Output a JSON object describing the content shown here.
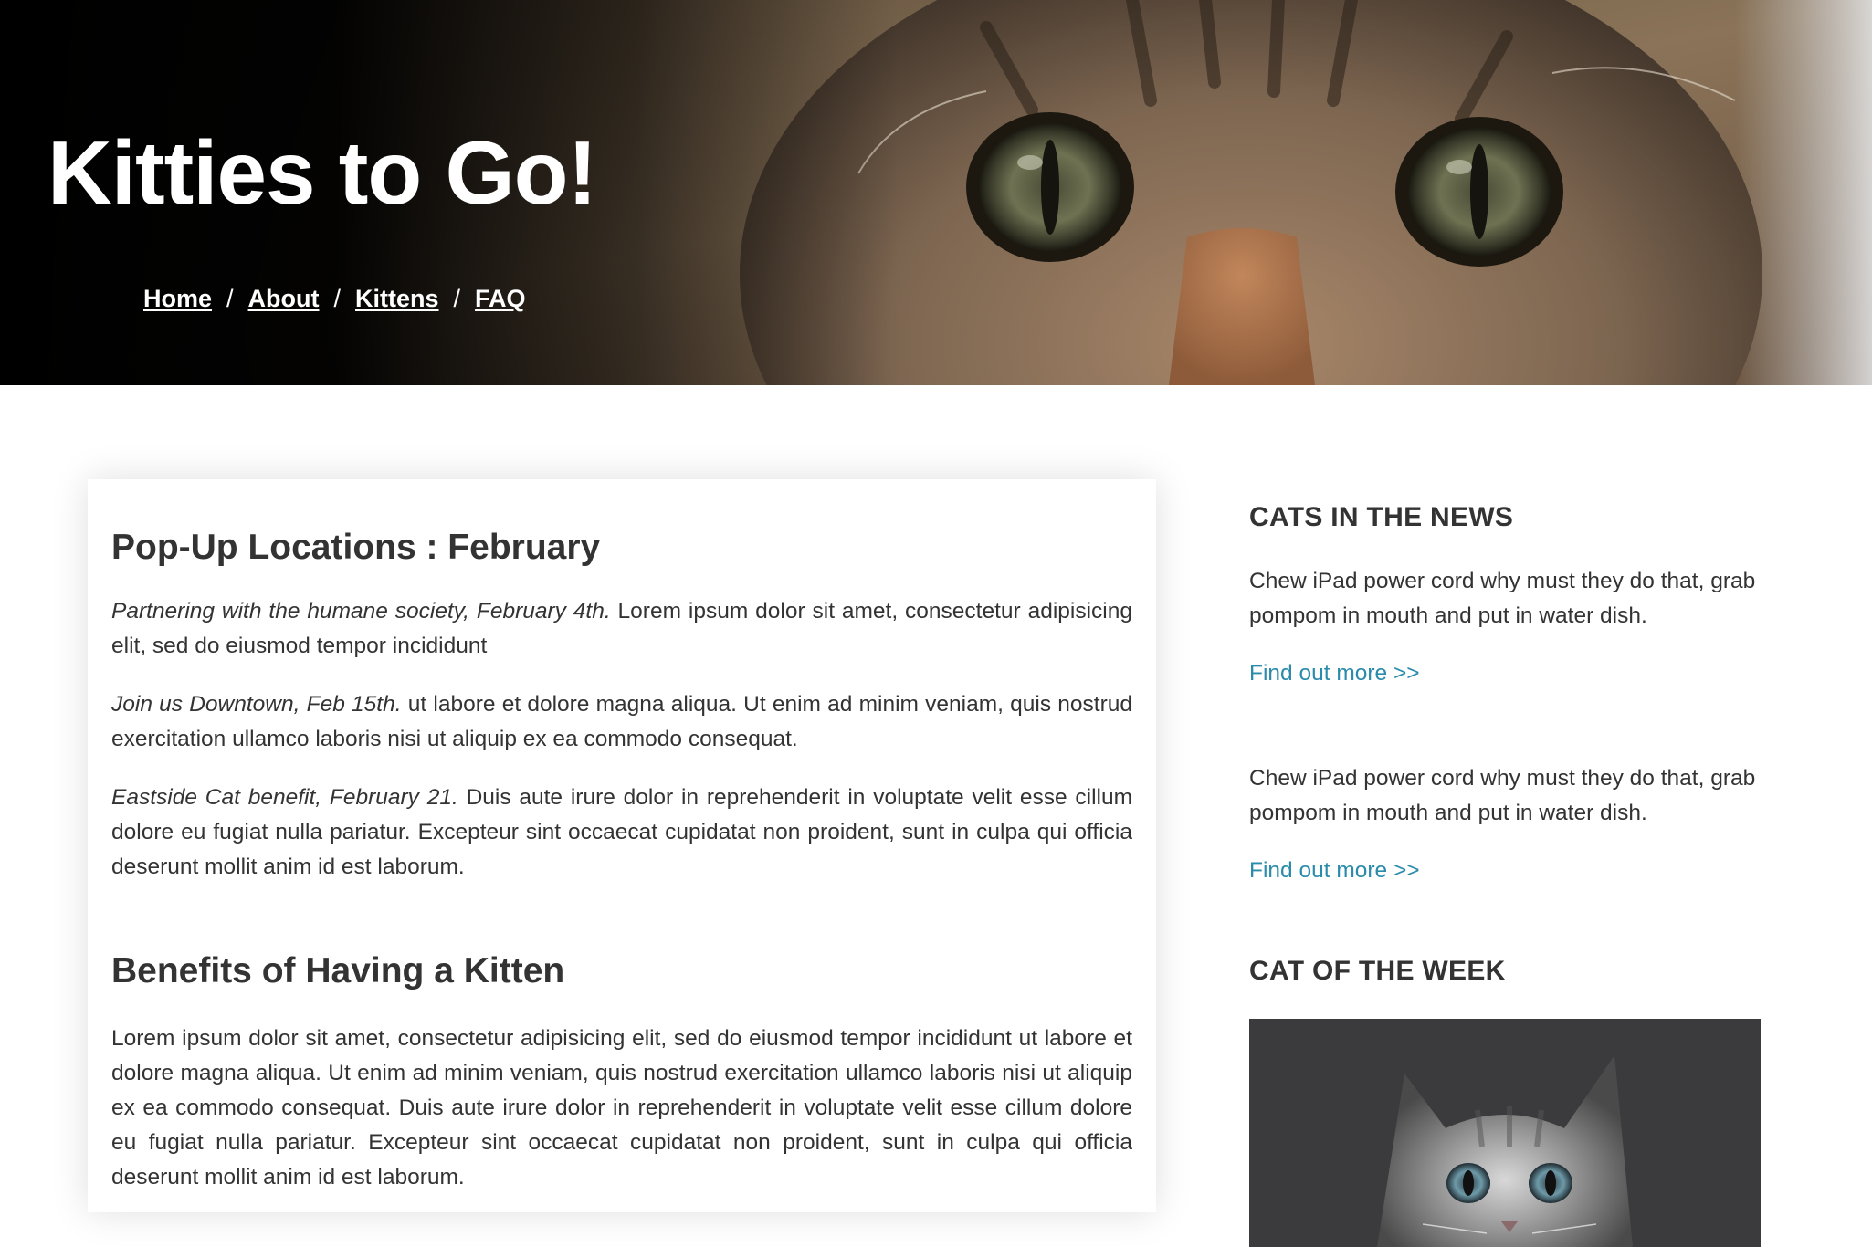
{
  "site": {
    "title": "Kitties to Go!"
  },
  "nav": {
    "items": [
      {
        "label": "Home"
      },
      {
        "label": "About"
      },
      {
        "label": "Kittens"
      },
      {
        "label": "FAQ"
      }
    ],
    "separator": "/"
  },
  "main": {
    "section1": {
      "heading": "Pop-Up Locations : February",
      "paragraphs": [
        {
          "lead": "Partnering with the humane society, February 4th.",
          "text": " Lorem ipsum dolor sit amet, consectetur adipisicing elit, sed do eiusmod tempor incididunt"
        },
        {
          "lead": "Join us Downtown, Feb 15th.",
          "text": " ut labore et dolore magna aliqua. Ut enim ad minim veniam, quis nostrud exercitation ullamco laboris nisi ut aliquip ex ea commodo consequat."
        },
        {
          "lead": "Eastside Cat benefit, February 21.",
          "text": " Duis aute irure dolor in reprehenderit in voluptate velit esse cillum dolore eu fugiat nulla pariatur. Excepteur sint occaecat cupidatat non proident, sunt in culpa qui officia deserunt mollit anim id est laborum."
        }
      ]
    },
    "section2": {
      "heading": "Benefits of Having a Kitten",
      "paragraph": "Lorem ipsum dolor sit amet, consectetur adipisicing elit, sed do eiusmod tempor incididunt ut labore et dolore magna aliqua. Ut enim ad minim veniam, quis nostrud exercitation ullamco laboris nisi ut aliquip ex ea commodo consequat. Duis aute irure dolor in reprehenderit in voluptate velit esse cillum dolore eu fugiat nulla pariatur. Excepteur sint occaecat cupidatat non proident, sunt in culpa qui officia deserunt mollit anim id est laborum."
    }
  },
  "sidebar": {
    "news_heading": "CATS IN THE NEWS",
    "news": [
      {
        "text": "Chew iPad power cord why must they do that, grab pompom in mouth and put in water dish.",
        "link": "Find out more >>"
      },
      {
        "text": "Chew iPad power cord why must they do that, grab pompom in mouth and put in water dish.",
        "link": "Find out more >>"
      }
    ],
    "week_heading": "CAT OF THE WEEK"
  },
  "colors": {
    "link": "#2a8bab",
    "text": "#333333",
    "hero_text": "#ffffff"
  }
}
